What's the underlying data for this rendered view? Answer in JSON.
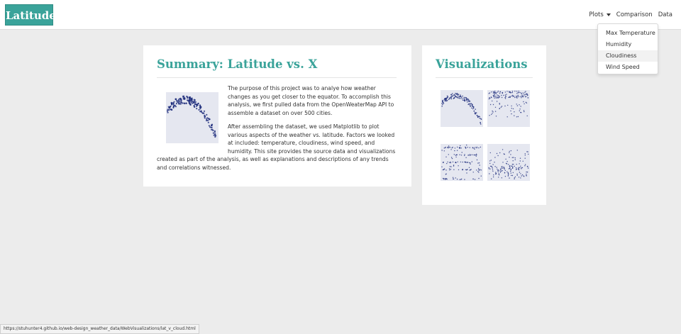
{
  "navbar": {
    "brand": "Latitude",
    "links": {
      "plots": "Plots",
      "comparison": "Comparison",
      "data": "Data"
    }
  },
  "dropdown": {
    "items": [
      "Max Temperature",
      "Humidity",
      "Cloudiness",
      "Wind Speed"
    ],
    "active_index": 2
  },
  "summary": {
    "title": "Summary: Latitude vs. X",
    "paragraph1": "The purpose of this project was to analye how weather changes as you get closer to the equator. To accomplish this analysis, we first pulled data from the OpenWeaterMap API to assemble a dataset on over 500 cities.",
    "paragraph2": "After assembling the dataset, we used Matplotlib to plot various aspects of the weather vs. latitude. Factors we looked at included: temperature, cloudiness, wind speed, and humidity. This site provides the source data and visualizations created as part of the analysis, as well as explanations and descriptions of any trends and correlations witnessed."
  },
  "visualizations": {
    "title": "Visualizations",
    "plots": [
      "max-temperature",
      "humidity",
      "cloudiness",
      "wind-speed"
    ]
  },
  "status_bar": {
    "url": "https://stuhunter4.github.io/web-design_weather_data/WebVisualizations/lat_v_cloud.html"
  },
  "colors": {
    "accent": "#3aa39a",
    "point": "#1c2a7a",
    "plot_bg": "#e5e7f0"
  }
}
